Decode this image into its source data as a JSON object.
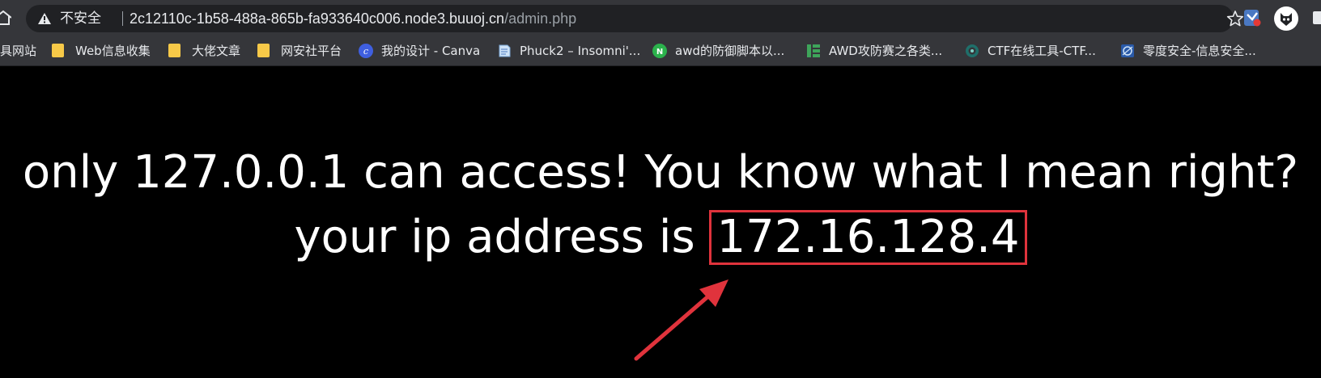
{
  "browser": {
    "security_label": "不安全",
    "url_host": "2c12110c-1b58-488a-865b-fa933640c006.node3.buuoj.cn",
    "url_path": "/admin.php",
    "icons": {
      "home": "home-icon",
      "warning": "warning-icon",
      "star": "star-icon",
      "extension_1": "extension-icon",
      "extension_2": "extension-icon"
    }
  },
  "bookmarks": [
    {
      "label": "具网站",
      "icon": "none"
    },
    {
      "label": "Web信息收集",
      "icon": "folder-icon"
    },
    {
      "label": "大佬文章",
      "icon": "folder-icon"
    },
    {
      "label": "网安社平台",
      "icon": "folder-icon"
    },
    {
      "label": "我的设计 - Canva",
      "icon": "canva-icon"
    },
    {
      "label": "Phuck2 – Insomni'...",
      "icon": "page-icon"
    },
    {
      "label": "awd的防御脚本以...",
      "icon": "n-icon"
    },
    {
      "label": "AWD攻防赛之各类...",
      "icon": "grid-icon"
    },
    {
      "label": "CTF在线工具-CTF...",
      "icon": "ctf-icon"
    },
    {
      "label": "零度安全-信息安全...",
      "icon": "zero-icon"
    }
  ],
  "page": {
    "line1": "only 127.0.0.1 can access! You know what I mean right?",
    "line2_prefix": "your ip address is",
    "ip_address": "172.16.128.4"
  },
  "colors": {
    "highlight": "#e0333c",
    "background": "#000000",
    "text": "#ffffff",
    "folder": "#f7c948"
  }
}
